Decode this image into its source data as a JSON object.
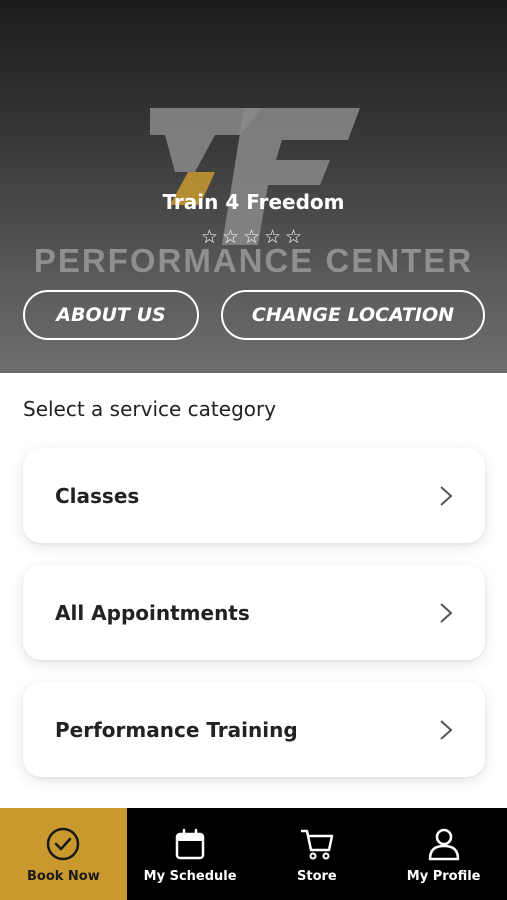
{
  "header": {
    "gym_name": "Train 4 Freedom",
    "rating_stars": "☆☆☆☆☆",
    "logo_text": "PERFORMANCE CENTER",
    "about_label": "ABOUT US",
    "location_label": "CHANGE LOCATION"
  },
  "main": {
    "section_title": "Select a service category",
    "categories": [
      {
        "label": "Classes"
      },
      {
        "label": "All Appointments"
      },
      {
        "label": "Performance Training"
      }
    ]
  },
  "tabbar": {
    "tabs": [
      {
        "label": "Book Now",
        "icon": "check-circle-icon",
        "active": true
      },
      {
        "label": "My Schedule",
        "icon": "calendar-icon",
        "active": false
      },
      {
        "label": "Store",
        "icon": "cart-icon",
        "active": false
      },
      {
        "label": "My Profile",
        "icon": "user-icon",
        "active": false
      }
    ]
  },
  "colors": {
    "accent": "#c9992e",
    "tabbar_bg": "#000000",
    "text_dark": "#222222"
  }
}
